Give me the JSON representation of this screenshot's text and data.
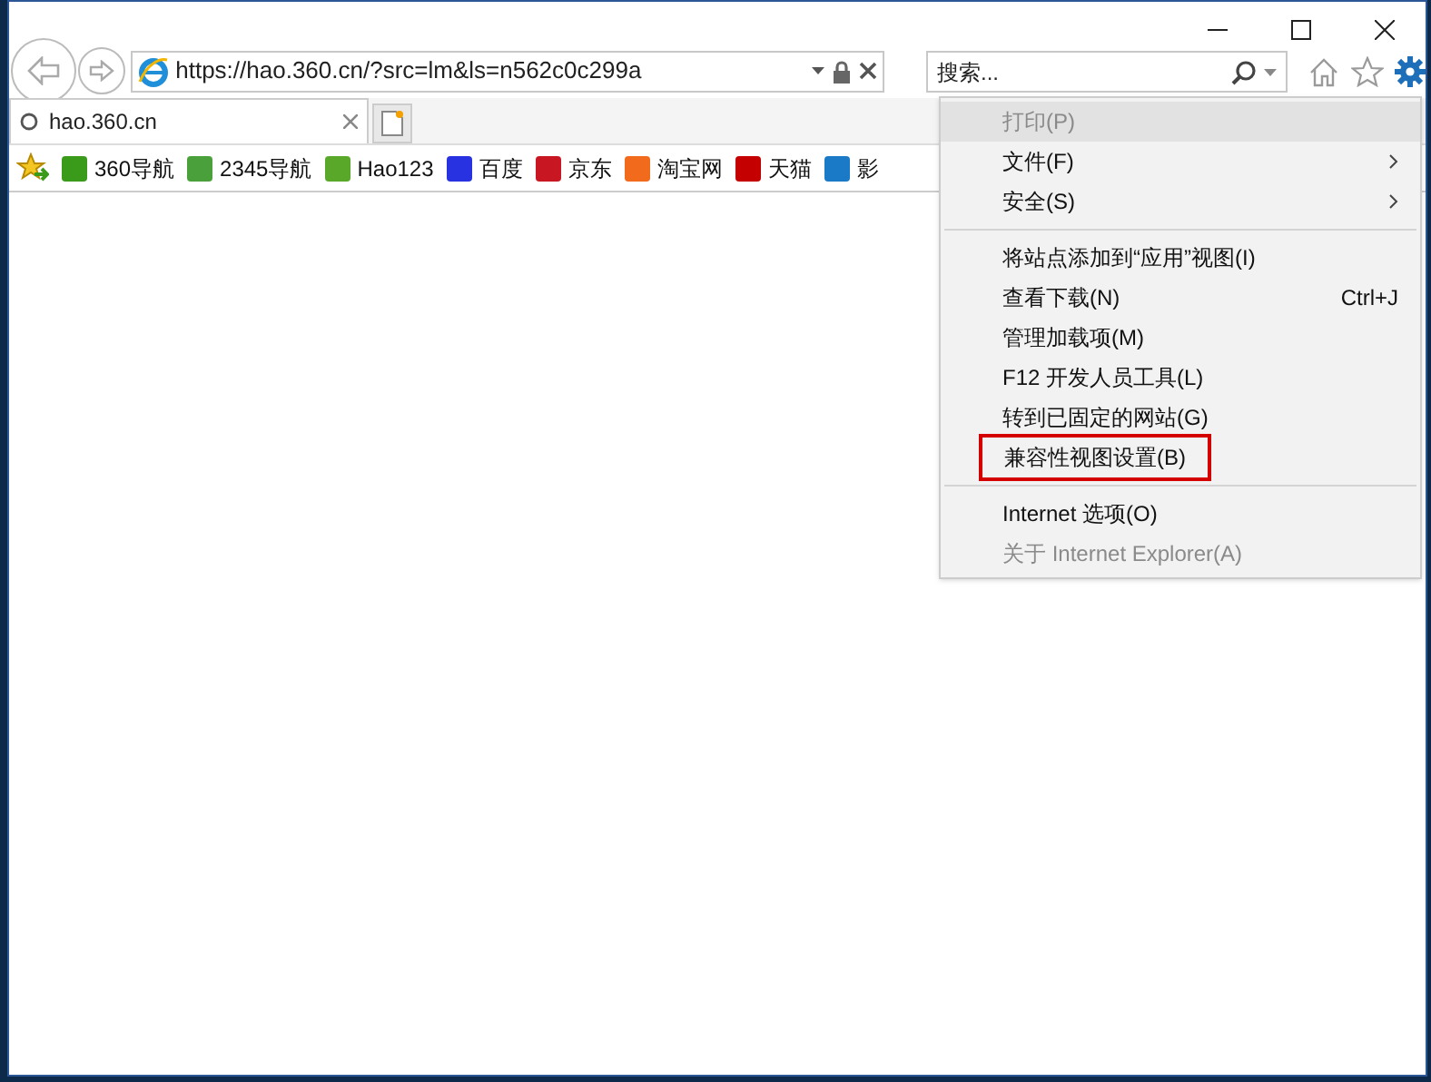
{
  "address_bar": {
    "url": "https://hao.360.cn/?src=lm&ls=n562c0c299a"
  },
  "search": {
    "placeholder": "搜索..."
  },
  "tabs": [
    {
      "label": "hao.360.cn",
      "selected": true
    }
  ],
  "favorites": [
    {
      "label": "360导航",
      "color": "#3a9a1a"
    },
    {
      "label": "2345导航",
      "color": "#4aa03a"
    },
    {
      "label": "Hao123",
      "color": "#5aa82a"
    },
    {
      "label": "百度",
      "color": "#2932e1"
    },
    {
      "label": "京东",
      "color": "#c81623"
    },
    {
      "label": "淘宝网",
      "color": "#f26a1b"
    },
    {
      "label": "天猫",
      "color": "#c40000"
    },
    {
      "label": "影",
      "color": "#1a7ac8"
    }
  ],
  "tools_menu": [
    {
      "kind": "item",
      "label": "打印(P)",
      "disabled": true,
      "highlighted": true,
      "submenu": false,
      "outlined": false
    },
    {
      "kind": "item",
      "label": "文件(F)",
      "disabled": false,
      "highlighted": false,
      "submenu": true,
      "outlined": false
    },
    {
      "kind": "item",
      "label": "安全(S)",
      "disabled": false,
      "highlighted": false,
      "submenu": true,
      "outlined": false
    },
    {
      "kind": "separator"
    },
    {
      "kind": "item",
      "label": "将站点添加到“应用”视图(I)",
      "disabled": false,
      "highlighted": false,
      "submenu": false,
      "outlined": false
    },
    {
      "kind": "item",
      "label": "查看下载(N)",
      "shortcut": "Ctrl+J",
      "disabled": false,
      "highlighted": false,
      "submenu": false,
      "outlined": false
    },
    {
      "kind": "item",
      "label": "管理加载项(M)",
      "disabled": false,
      "highlighted": false,
      "submenu": false,
      "outlined": false
    },
    {
      "kind": "item",
      "label": "F12 开发人员工具(L)",
      "disabled": false,
      "highlighted": false,
      "submenu": false,
      "outlined": false
    },
    {
      "kind": "item",
      "label": "转到已固定的网站(G)",
      "disabled": false,
      "highlighted": false,
      "submenu": false,
      "outlined": false
    },
    {
      "kind": "item",
      "label": "兼容性视图设置(B)",
      "disabled": false,
      "highlighted": false,
      "submenu": false,
      "outlined": true
    },
    {
      "kind": "separator"
    },
    {
      "kind": "item",
      "label": "Internet 选项(O)",
      "disabled": false,
      "highlighted": false,
      "submenu": false,
      "outlined": false
    },
    {
      "kind": "item",
      "label": "关于 Internet Explorer(A)",
      "disabled": true,
      "highlighted": false,
      "submenu": false,
      "outlined": false
    }
  ]
}
